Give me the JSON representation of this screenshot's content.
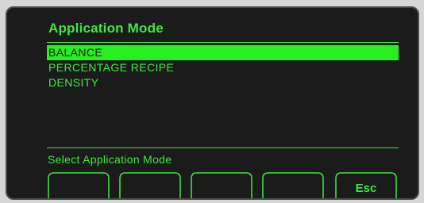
{
  "screen": {
    "title": "Application Mode",
    "status": "Select Application Mode"
  },
  "menu": {
    "items": [
      {
        "label": "BALANCE",
        "selected": true
      },
      {
        "label": "PERCENTAGE RECIPE",
        "selected": false
      },
      {
        "label": "DENSITY",
        "selected": false
      }
    ]
  },
  "softkeys": {
    "esc_label": "Esc",
    "icons": [
      "arrow-up-icon",
      "arrow-down-icon",
      "enter-icon",
      "",
      ""
    ]
  },
  "colors": {
    "text_green": "#3fe93f",
    "highlight_green": "#27ee1e",
    "screen_bg": "#1b1b1b"
  }
}
